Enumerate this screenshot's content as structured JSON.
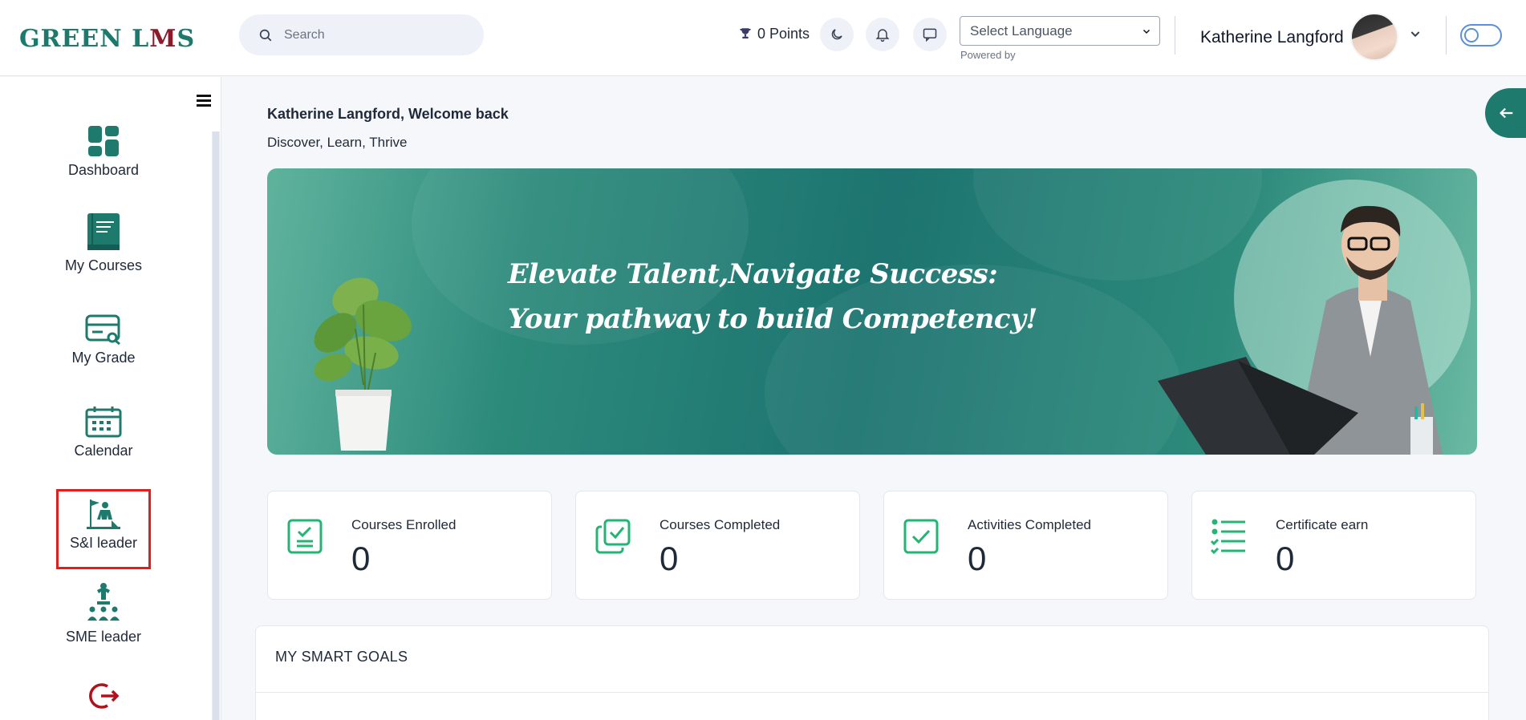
{
  "header": {
    "logo_text_a": "GREEN L",
    "logo_text_m": "M",
    "logo_text_s": "S",
    "search_placeholder": "Search",
    "points": "0 Points",
    "language_select": "Select Language",
    "powered_by": "Powered by",
    "user_name": "Katherine Langford"
  },
  "sidebar": {
    "items": [
      {
        "label": "Dashboard",
        "icon": "dashboard-grid-icon"
      },
      {
        "label": "My Courses",
        "icon": "book-icon"
      },
      {
        "label": "My Grade",
        "icon": "grade-card-icon"
      },
      {
        "label": "Calendar",
        "icon": "calendar-icon"
      },
      {
        "label": "S&I leader",
        "icon": "leader-flag-icon",
        "selected": true
      },
      {
        "label": "SME leader",
        "icon": "sme-group-icon"
      }
    ],
    "logout_icon": "logout-icon"
  },
  "main": {
    "welcome": "Katherine Langford, Welcome back",
    "tagline": "Discover, Learn, Thrive",
    "banner_line1": "Elevate Talent,Navigate Success:",
    "banner_line2": "Your pathway to build Competency!",
    "stats": [
      {
        "title": "Courses Enrolled",
        "value": "0",
        "icon": "clipboard-check-icon"
      },
      {
        "title": "Courses Completed",
        "value": "0",
        "icon": "stacked-check-icon"
      },
      {
        "title": "Activities Completed",
        "value": "0",
        "icon": "checkbox-icon"
      },
      {
        "title": "Certificate earn",
        "value": "0",
        "icon": "checklist-icon"
      }
    ],
    "goals_title": "MY SMART GOALS"
  },
  "colors": {
    "brand_teal": "#1f7a6e",
    "icon_green": "#22b573",
    "selection_red": "#e11d1d"
  }
}
